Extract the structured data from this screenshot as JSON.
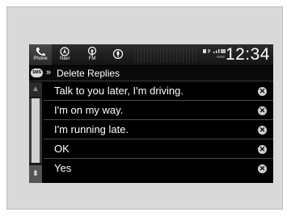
{
  "topbar": {
    "sources": [
      {
        "label": "Phone",
        "icon": "phone-icon",
        "active": true
      },
      {
        "label": "Navi",
        "icon": "compass-icon",
        "active": false
      },
      {
        "label": "FM",
        "icon": "radio-icon",
        "active": false
      },
      {
        "label": "",
        "icon": "siri-icon",
        "active": false
      }
    ],
    "clock": "12:34"
  },
  "header": {
    "badge": "SMS",
    "chevrons": "»",
    "title": "Delete Replies"
  },
  "replies": [
    {
      "text": "Talk to you later, I'm driving."
    },
    {
      "text": "I'm on my way."
    },
    {
      "text": "I'm running late."
    },
    {
      "text": "OK"
    },
    {
      "text": "Yes"
    }
  ],
  "scroll": {
    "up_glyph": "▲",
    "down_glyph": "⇟"
  },
  "colors": {
    "screen_bg": "#000000",
    "text": "#ffffff",
    "divider": "#4a4a4a",
    "delete_icon": "#d0d0d0"
  }
}
